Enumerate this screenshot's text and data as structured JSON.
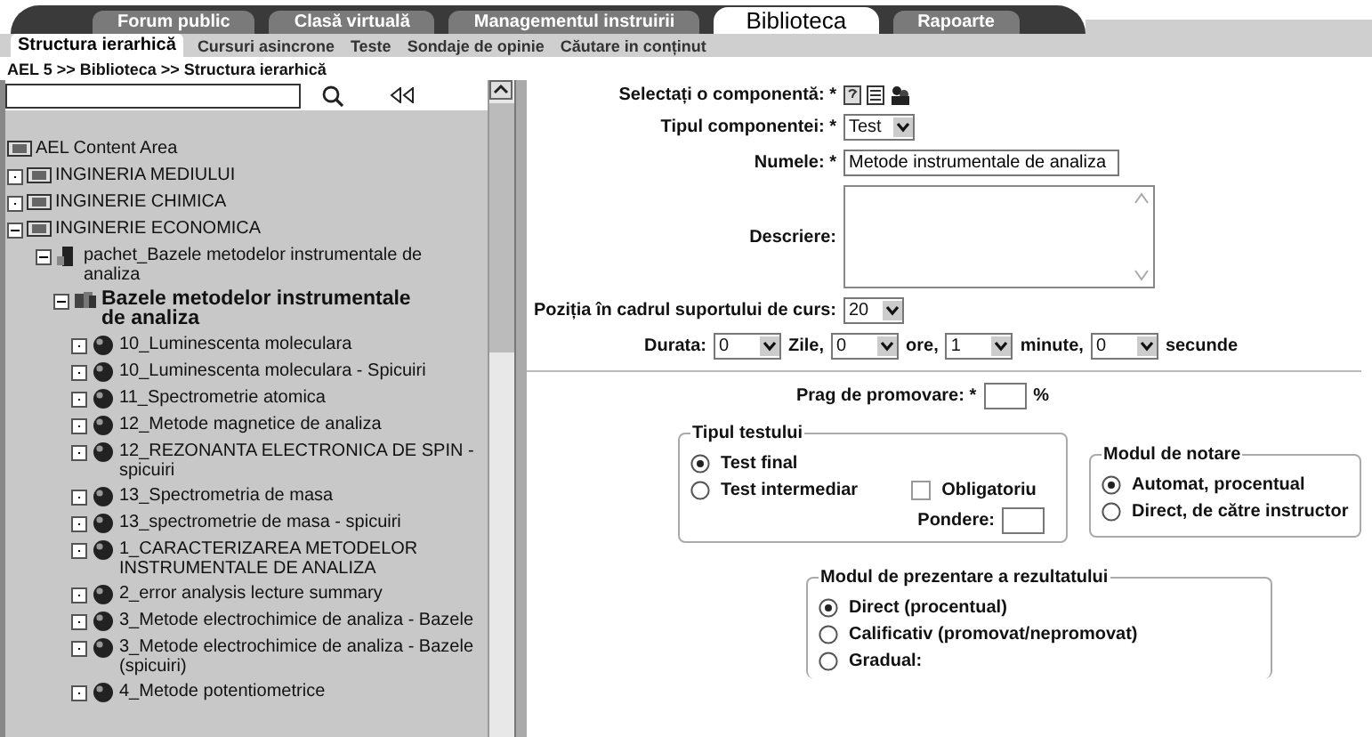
{
  "top_tabs": [
    {
      "label": "Forum public",
      "selected": false
    },
    {
      "label": "Clasă virtuală",
      "selected": false
    },
    {
      "label": "Managementul instruirii",
      "selected": false
    },
    {
      "label": "Biblioteca",
      "selected": true
    },
    {
      "label": "Rapoarte",
      "selected": false
    }
  ],
  "sub_tabs": [
    {
      "label": "Structura ierarhică",
      "selected": true
    },
    {
      "label": "Cursuri asincrone",
      "selected": false
    },
    {
      "label": "Teste",
      "selected": false
    },
    {
      "label": "Sondaje de opinie",
      "selected": false
    },
    {
      "label": "Căutare in conținut",
      "selected": false
    }
  ],
  "breadcrumb": "AEL 5 >> Biblioteca >> Structura ierarhică",
  "tree": [
    {
      "label": "AEL Content Area",
      "kind": "folder"
    },
    {
      "label": "INGINERIA MEDIULUI",
      "kind": "folder",
      "expanded": false
    },
    {
      "label": "INGINERIE CHIMICA",
      "kind": "folder",
      "expanded": false
    },
    {
      "label": "INGINERIE ECONOMICA",
      "kind": "folder",
      "expanded": true,
      "children": [
        {
          "label": "pachet_Bazele metodelor instrumentale de analiza",
          "kind": "package",
          "expanded": true,
          "children": [
            {
              "label": "Bazele metodelor instrumentale de analiza",
              "kind": "course",
              "expanded": true,
              "children": [
                {
                  "label": "10_Luminescenta moleculara",
                  "kind": "lesson",
                  "expanded": false
                },
                {
                  "label": "10_Luminescenta moleculara - Spicuiri",
                  "kind": "lesson",
                  "expanded": false
                },
                {
                  "label": "11_Spectrometrie atomica",
                  "kind": "lesson",
                  "expanded": false
                },
                {
                  "label": "12_Metode magnetice de analiza",
                  "kind": "lesson",
                  "expanded": false
                },
                {
                  "label": "12_REZONANTA ELECTRONICA DE SPIN - spicuiri",
                  "kind": "lesson",
                  "expanded": false
                },
                {
                  "label": "13_Spectrometria de masa",
                  "kind": "lesson",
                  "expanded": false
                },
                {
                  "label": "13_spectrometrie de masa - spicuiri",
                  "kind": "lesson",
                  "expanded": false
                },
                {
                  "label": "1_CARACTERIZAREA METODELOR INSTRUMENTALE DE ANALIZA",
                  "kind": "lesson",
                  "expanded": false
                },
                {
                  "label": "2_error analysis lecture summary",
                  "kind": "lesson",
                  "expanded": false
                },
                {
                  "label": "3_Metode electrochimice de analiza - Bazele",
                  "kind": "lesson",
                  "expanded": false
                },
                {
                  "label": "3_Metode electrochimice de analiza - Bazele (spicuiri)",
                  "kind": "lesson",
                  "expanded": false
                },
                {
                  "label": "4_Metode potentiometrice",
                  "kind": "lesson",
                  "expanded": false
                }
              ]
            }
          ]
        }
      ]
    }
  ],
  "form": {
    "component": {
      "label": "Selectați o componentă: *"
    },
    "type": {
      "label": "Tipul componentei: *",
      "value": "Test"
    },
    "name": {
      "label": "Numele: *",
      "value": "Metode instrumentale de analiza"
    },
    "description": {
      "label": "Descriere:"
    },
    "position": {
      "label": "Poziția în cadrul suportului de curs:",
      "value": "20"
    },
    "duration": {
      "label": "Durata:",
      "parts": [
        {
          "value": "0",
          "unit": "Zile,"
        },
        {
          "value": "0",
          "unit": "ore,"
        },
        {
          "value": "1",
          "unit": "minute,"
        },
        {
          "value": "0",
          "unit": "secunde"
        }
      ]
    },
    "pass_threshold": {
      "label": "Prag de promovare: *",
      "unit": "%"
    },
    "test_type": {
      "legend": "Tipul testului",
      "options": [
        {
          "label": "Test final",
          "selected": true
        },
        {
          "label": "Test intermediar",
          "selected": false
        }
      ],
      "mandatory": {
        "label": "Obligatoriu",
        "checked": false
      },
      "weight": {
        "label": "Pondere:"
      }
    },
    "grading": {
      "legend": "Modul de notare",
      "options": [
        {
          "label": "Automat, procentual",
          "selected": true
        },
        {
          "label": "Direct, de către instructor",
          "selected": false
        }
      ]
    },
    "result": {
      "legend": "Modul de prezentare a rezultatului",
      "options": [
        {
          "label": "Direct (procentual)",
          "selected": true
        },
        {
          "label": "Calificativ (promovat/nepromovat)",
          "selected": false
        },
        {
          "label": "Gradual:",
          "selected": false
        }
      ]
    }
  }
}
